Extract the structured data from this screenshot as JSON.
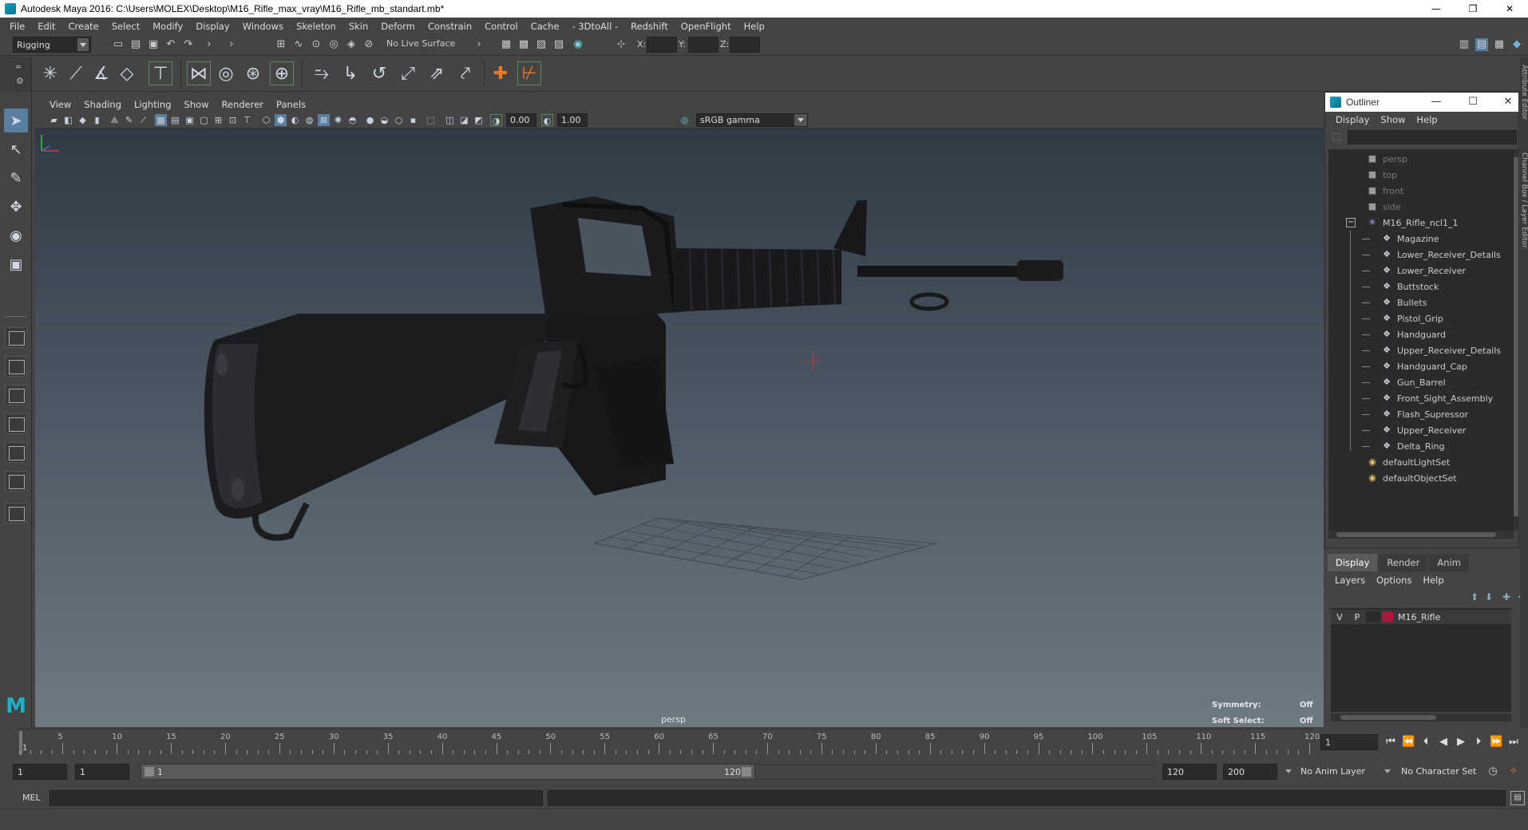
{
  "window": {
    "title": "Autodesk Maya 2016: C:\\Users\\MOLEX\\Desktop\\M16_Rifle_max_vray\\M16_Rifle_mb_standart.mb*",
    "controls": {
      "minimize": "—",
      "restore": "❐",
      "close": "✕"
    }
  },
  "menubar": {
    "items": [
      "File",
      "Edit",
      "Create",
      "Select",
      "Modify",
      "Display",
      "Windows",
      "Skeleton",
      "Skin",
      "Deform",
      "Constrain",
      "Control",
      "Cache",
      "- 3DtoAll -",
      "Redshift",
      "OpenFlight",
      "Help"
    ]
  },
  "statusline": {
    "menuset": "Rigging",
    "live_surface": "No Live Surface",
    "x_label": "X:",
    "y_label": "Y:",
    "z_label": "Z:"
  },
  "panel": {
    "menus": [
      "View",
      "Shading",
      "Lighting",
      "Show",
      "Renderer",
      "Panels"
    ],
    "exposure": "0.00",
    "gamma": "1.00",
    "color_space": "sRGB gamma",
    "camera": "persp",
    "hud": {
      "symmetry_label": "Symmetry:",
      "symmetry_value": "Off",
      "soft_select_label": "Soft Select:",
      "soft_select_value": "Off"
    }
  },
  "outliner": {
    "title": "Outliner",
    "menus": [
      "Display",
      "Show",
      "Help"
    ],
    "cameras": [
      "persp",
      "top",
      "front",
      "side"
    ],
    "group": "M16_Rifle_ncl1_1",
    "group_expander": "−",
    "children": [
      "Magazine",
      "Lower_Receiver_Details",
      "Lower_Receiver",
      "Buttstock",
      "Bullets",
      "Pistol_Grip",
      "Handguard",
      "Upper_Receiver_Details",
      "Handguard_Cap",
      "Gun_Barrel",
      "Front_Sight_Assembly",
      "Flash_Supressor",
      "Upper_Receiver",
      "Delta_Ring"
    ],
    "sets": [
      "defaultLightSet",
      "defaultObjectSet"
    ]
  },
  "layer_editor": {
    "tabs": [
      "Display",
      "Render",
      "Anim"
    ],
    "active_tab": "Display",
    "menus": [
      "Layers",
      "Options",
      "Help"
    ],
    "layer": {
      "visible": "V",
      "playback": "P",
      "name": "M16_Rifle",
      "color": "#b0163a"
    }
  },
  "side_strip": {
    "labels": [
      "Attribute Editor",
      "Channel Box / Layer Editor"
    ]
  },
  "timeline": {
    "ticks": [
      5,
      10,
      15,
      20,
      25,
      30,
      35,
      40,
      45,
      50,
      55,
      60,
      65,
      70,
      75,
      80,
      85,
      90,
      95,
      100,
      105,
      110,
      115,
      120
    ],
    "current_frame": "1",
    "current_frame_field": "1"
  },
  "range": {
    "start_field": "1",
    "playback_start_field": "1",
    "slider_start": "1",
    "slider_end": "120",
    "playback_end_field": "120",
    "end_field": "200",
    "anim_layer": "No Anim Layer",
    "character_set": "No Character Set"
  },
  "command_line": {
    "language": "MEL"
  },
  "colors": {
    "accent": "#12a4c7",
    "active_tool": "#5a7fa0",
    "layer_red": "#b0163a"
  }
}
